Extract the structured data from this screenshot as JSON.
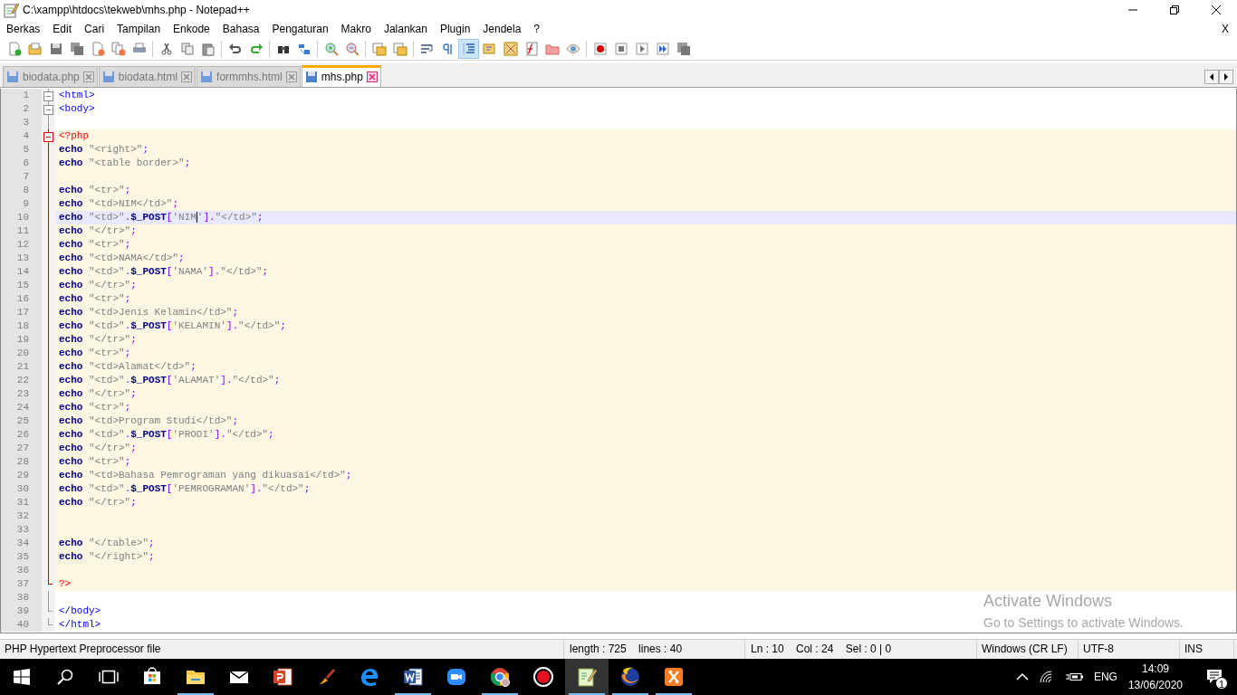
{
  "window": {
    "title": "C:\\xampp\\htdocs\\tekweb\\mhs.php - Notepad++"
  },
  "menu": [
    "Berkas",
    "Edit",
    "Cari",
    "Tampilan",
    "Enkode",
    "Bahasa",
    "Pengaturan",
    "Makro",
    "Jalankan",
    "Plugin",
    "Jendela",
    "?"
  ],
  "menu_close": "X",
  "toolbar": {
    "indent_guide_on": true
  },
  "tabs": [
    {
      "label": "biodata.php",
      "selected": false
    },
    {
      "label": "biodata.html",
      "selected": false
    },
    {
      "label": "formmhs.html",
      "selected": false
    },
    {
      "label": "mhs.php",
      "selected": true
    }
  ],
  "editor": {
    "lines": [
      {
        "num": "1",
        "php": false,
        "fold_start": true,
        "fold_end": false,
        "current": false,
        "tokens": [
          {
            "kind": "tag",
            "text": "<html>"
          }
        ]
      },
      {
        "num": "2",
        "php": false,
        "fold_start": true,
        "fold_end": false,
        "current": false,
        "tokens": [
          {
            "kind": "tag",
            "text": "<body>"
          }
        ]
      },
      {
        "num": "3",
        "php": false,
        "fold_start": false,
        "fold_end": false,
        "current": false
      },
      {
        "num": "4",
        "php": true,
        "fold_start": true,
        "fold_end": false,
        "current": false,
        "tokens": [
          {
            "kind": "php-tag",
            "text": "<?php"
          }
        ]
      },
      {
        "num": "5",
        "php": true,
        "fold_start": false,
        "fold_end": false,
        "current": false,
        "tokens": [
          {
            "kind": "keyword",
            "text": "echo"
          },
          {
            "kind": "string",
            "text": " \"<right>\""
          },
          {
            "kind": "operator",
            "text": ";"
          }
        ]
      },
      {
        "num": "6",
        "php": true,
        "fold_start": false,
        "fold_end": false,
        "current": false,
        "tokens": [
          {
            "kind": "keyword",
            "text": "echo"
          },
          {
            "kind": "string",
            "text": " \"<table border>\""
          },
          {
            "kind": "operator",
            "text": ";"
          }
        ]
      },
      {
        "num": "7",
        "php": true,
        "fold_start": false,
        "fold_end": false,
        "current": false
      },
      {
        "num": "8",
        "php": true,
        "fold_start": false,
        "fold_end": false,
        "current": false,
        "tokens": [
          {
            "kind": "keyword",
            "text": "echo"
          },
          {
            "kind": "string",
            "text": " \"<tr>\""
          },
          {
            "kind": "operator",
            "text": ";"
          }
        ]
      },
      {
        "num": "9",
        "php": true,
        "fold_start": false,
        "fold_end": false,
        "current": false,
        "tokens": [
          {
            "kind": "keyword",
            "text": "echo"
          },
          {
            "kind": "string",
            "text": " \"<td>NIM</td>\""
          },
          {
            "kind": "operator",
            "text": ";"
          }
        ]
      },
      {
        "num": "10",
        "php": true,
        "fold_start": false,
        "fold_end": false,
        "current": true,
        "tokens": [
          {
            "kind": "keyword",
            "text": "echo"
          },
          {
            "kind": "string",
            "text": " \"<td>\""
          },
          {
            "kind": "operator",
            "text": "."
          },
          {
            "kind": "keyword",
            "text": "$_POST"
          },
          {
            "kind": "operator",
            "text": "["
          },
          {
            "kind": "string",
            "text": "'NIM"
          },
          {
            "kind": "caret-string",
            "text": "'"
          },
          {
            "kind": "operator",
            "text": "]"
          },
          {
            "kind": "operator",
            "text": "."
          },
          {
            "kind": "string",
            "text": "\"</td>\""
          },
          {
            "kind": "operator",
            "text": ";"
          }
        ]
      },
      {
        "num": "11",
        "php": true,
        "fold_start": false,
        "fold_end": false,
        "current": false,
        "tokens": [
          {
            "kind": "keyword",
            "text": "echo"
          },
          {
            "kind": "string",
            "text": " \"</tr>\""
          },
          {
            "kind": "operator",
            "text": ";"
          }
        ]
      },
      {
        "num": "12",
        "php": true,
        "fold_start": false,
        "fold_end": false,
        "current": false,
        "tokens": [
          {
            "kind": "keyword",
            "text": "echo"
          },
          {
            "kind": "string",
            "text": " \"<tr>\""
          },
          {
            "kind": "operator",
            "text": ";"
          }
        ]
      },
      {
        "num": "13",
        "php": true,
        "fold_start": false,
        "fold_end": false,
        "current": false,
        "tokens": [
          {
            "kind": "keyword",
            "text": "echo"
          },
          {
            "kind": "string",
            "text": " \"<td>NAMA</td>\""
          },
          {
            "kind": "operator",
            "text": ";"
          }
        ]
      },
      {
        "num": "14",
        "php": true,
        "fold_start": false,
        "fold_end": false,
        "current": false,
        "tokens": [
          {
            "kind": "keyword",
            "text": "echo"
          },
          {
            "kind": "string",
            "text": " \"<td>\""
          },
          {
            "kind": "operator",
            "text": "."
          },
          {
            "kind": "keyword",
            "text": "$_POST"
          },
          {
            "kind": "operator",
            "text": "["
          },
          {
            "kind": "string",
            "text": "'NAMA'"
          },
          {
            "kind": "operator",
            "text": "]"
          },
          {
            "kind": "operator",
            "text": "."
          },
          {
            "kind": "string",
            "text": "\"</td>\""
          },
          {
            "kind": "operator",
            "text": ";"
          }
        ]
      },
      {
        "num": "15",
        "php": true,
        "fold_start": false,
        "fold_end": false,
        "current": false,
        "tokens": [
          {
            "kind": "keyword",
            "text": "echo"
          },
          {
            "kind": "string",
            "text": " \"</tr>\""
          },
          {
            "kind": "operator",
            "text": ";"
          }
        ]
      },
      {
        "num": "16",
        "php": true,
        "fold_start": false,
        "fold_end": false,
        "current": false,
        "tokens": [
          {
            "kind": "keyword",
            "text": "echo"
          },
          {
            "kind": "string",
            "text": " \"<tr>\""
          },
          {
            "kind": "operator",
            "text": ";"
          }
        ]
      },
      {
        "num": "17",
        "php": true,
        "fold_start": false,
        "fold_end": false,
        "current": false,
        "tokens": [
          {
            "kind": "keyword",
            "text": "echo"
          },
          {
            "kind": "string",
            "text": " \"<td>Jenis Kelamin</td>\""
          },
          {
            "kind": "operator",
            "text": ";"
          }
        ]
      },
      {
        "num": "18",
        "php": true,
        "fold_start": false,
        "fold_end": false,
        "current": false,
        "tokens": [
          {
            "kind": "keyword",
            "text": "echo"
          },
          {
            "kind": "string",
            "text": " \"<td>\""
          },
          {
            "kind": "operator",
            "text": "."
          },
          {
            "kind": "keyword",
            "text": "$_POST"
          },
          {
            "kind": "operator",
            "text": "["
          },
          {
            "kind": "string",
            "text": "'KELAMIN'"
          },
          {
            "kind": "operator",
            "text": "]"
          },
          {
            "kind": "operator",
            "text": "."
          },
          {
            "kind": "string",
            "text": "\"</td>\""
          },
          {
            "kind": "operator",
            "text": ";"
          }
        ]
      },
      {
        "num": "19",
        "php": true,
        "fold_start": false,
        "fold_end": false,
        "current": false,
        "tokens": [
          {
            "kind": "keyword",
            "text": "echo"
          },
          {
            "kind": "string",
            "text": " \"</tr>\""
          },
          {
            "kind": "operator",
            "text": ";"
          }
        ]
      },
      {
        "num": "20",
        "php": true,
        "fold_start": false,
        "fold_end": false,
        "current": false,
        "tokens": [
          {
            "kind": "keyword",
            "text": "echo"
          },
          {
            "kind": "string",
            "text": " \"<tr>\""
          },
          {
            "kind": "operator",
            "text": ";"
          }
        ]
      },
      {
        "num": "21",
        "php": true,
        "fold_start": false,
        "fold_end": false,
        "current": false,
        "tokens": [
          {
            "kind": "keyword",
            "text": "echo"
          },
          {
            "kind": "string",
            "text": " \"<td>Alamat</td>\""
          },
          {
            "kind": "operator",
            "text": ";"
          }
        ]
      },
      {
        "num": "22",
        "php": true,
        "fold_start": false,
        "fold_end": false,
        "current": false,
        "tokens": [
          {
            "kind": "keyword",
            "text": "echo"
          },
          {
            "kind": "string",
            "text": " \"<td>\""
          },
          {
            "kind": "operator",
            "text": "."
          },
          {
            "kind": "keyword",
            "text": "$_POST"
          },
          {
            "kind": "operator",
            "text": "["
          },
          {
            "kind": "string",
            "text": "'ALAMAT'"
          },
          {
            "kind": "operator",
            "text": "]"
          },
          {
            "kind": "operator",
            "text": "."
          },
          {
            "kind": "string",
            "text": "\"</td>\""
          },
          {
            "kind": "operator",
            "text": ";"
          }
        ]
      },
      {
        "num": "23",
        "php": true,
        "fold_start": false,
        "fold_end": false,
        "current": false,
        "tokens": [
          {
            "kind": "keyword",
            "text": "echo"
          },
          {
            "kind": "string",
            "text": " \"</tr>\""
          },
          {
            "kind": "operator",
            "text": ";"
          }
        ]
      },
      {
        "num": "24",
        "php": true,
        "fold_start": false,
        "fold_end": false,
        "current": false,
        "tokens": [
          {
            "kind": "keyword",
            "text": "echo"
          },
          {
            "kind": "string",
            "text": " \"<tr>\""
          },
          {
            "kind": "operator",
            "text": ";"
          }
        ]
      },
      {
        "num": "25",
        "php": true,
        "fold_start": false,
        "fold_end": false,
        "current": false,
        "tokens": [
          {
            "kind": "keyword",
            "text": "echo"
          },
          {
            "kind": "string",
            "text": " \"<td>Program Studi</td>\""
          },
          {
            "kind": "operator",
            "text": ";"
          }
        ]
      },
      {
        "num": "26",
        "php": true,
        "fold_start": false,
        "fold_end": false,
        "current": false,
        "tokens": [
          {
            "kind": "keyword",
            "text": "echo"
          },
          {
            "kind": "string",
            "text": " \"<td>\""
          },
          {
            "kind": "operator",
            "text": "."
          },
          {
            "kind": "keyword",
            "text": "$_POST"
          },
          {
            "kind": "operator",
            "text": "["
          },
          {
            "kind": "string",
            "text": "'PRODI'"
          },
          {
            "kind": "operator",
            "text": "]"
          },
          {
            "kind": "operator",
            "text": "."
          },
          {
            "kind": "string",
            "text": "\"</td>\""
          },
          {
            "kind": "operator",
            "text": ";"
          }
        ]
      },
      {
        "num": "27",
        "php": true,
        "fold_start": false,
        "fold_end": false,
        "current": false,
        "tokens": [
          {
            "kind": "keyword",
            "text": "echo"
          },
          {
            "kind": "string",
            "text": " \"</tr>\""
          },
          {
            "kind": "operator",
            "text": ";"
          }
        ]
      },
      {
        "num": "28",
        "php": true,
        "fold_start": false,
        "fold_end": false,
        "current": false,
        "tokens": [
          {
            "kind": "keyword",
            "text": "echo"
          },
          {
            "kind": "string",
            "text": " \"<tr>\""
          },
          {
            "kind": "operator",
            "text": ";"
          }
        ]
      },
      {
        "num": "29",
        "php": true,
        "fold_start": false,
        "fold_end": false,
        "current": false,
        "tokens": [
          {
            "kind": "keyword",
            "text": "echo"
          },
          {
            "kind": "string",
            "text": " \"<td>Bahasa Pemrograman yang dikuasai</td>\""
          },
          {
            "kind": "operator",
            "text": ";"
          }
        ]
      },
      {
        "num": "30",
        "php": true,
        "fold_start": false,
        "fold_end": false,
        "current": false,
        "tokens": [
          {
            "kind": "keyword",
            "text": "echo"
          },
          {
            "kind": "string",
            "text": " \"<td>\""
          },
          {
            "kind": "operator",
            "text": "."
          },
          {
            "kind": "keyword",
            "text": "$_POST"
          },
          {
            "kind": "operator",
            "text": "["
          },
          {
            "kind": "string",
            "text": "'PEMROGRAMAN'"
          },
          {
            "kind": "operator",
            "text": "]"
          },
          {
            "kind": "operator",
            "text": "."
          },
          {
            "kind": "string",
            "text": "\"</td>\""
          },
          {
            "kind": "operator",
            "text": ";"
          }
        ]
      },
      {
        "num": "31",
        "php": true,
        "fold_start": false,
        "fold_end": false,
        "current": false,
        "tokens": [
          {
            "kind": "keyword",
            "text": "echo"
          },
          {
            "kind": "string",
            "text": " \"</tr>\""
          },
          {
            "kind": "operator",
            "text": ";"
          }
        ]
      },
      {
        "num": "32",
        "php": true,
        "fold_start": false,
        "fold_end": false,
        "current": false
      },
      {
        "num": "33",
        "php": true,
        "fold_start": false,
        "fold_end": false,
        "current": false
      },
      {
        "num": "34",
        "php": true,
        "fold_start": false,
        "fold_end": false,
        "current": false,
        "tokens": [
          {
            "kind": "keyword",
            "text": "echo"
          },
          {
            "kind": "string",
            "text": " \"</table>\""
          },
          {
            "kind": "operator",
            "text": ";"
          }
        ]
      },
      {
        "num": "35",
        "php": true,
        "fold_start": false,
        "fold_end": false,
        "current": false,
        "tokens": [
          {
            "kind": "keyword",
            "text": "echo"
          },
          {
            "kind": "string",
            "text": " \"</right>\""
          },
          {
            "kind": "operator",
            "text": ";"
          }
        ]
      },
      {
        "num": "36",
        "php": true,
        "fold_start": false,
        "fold_end": false,
        "current": false
      },
      {
        "num": "37",
        "php": true,
        "fold_start": false,
        "fold_end": true,
        "current": false,
        "tokens": [
          {
            "kind": "php-tag",
            "text": "?>"
          }
        ]
      },
      {
        "num": "38",
        "php": false,
        "fold_start": false,
        "fold_end": false,
        "current": false
      },
      {
        "num": "39",
        "php": false,
        "fold_start": false,
        "fold_end": true,
        "current": false,
        "tokens": [
          {
            "kind": "tag",
            "text": "</body>"
          }
        ]
      },
      {
        "num": "40",
        "php": false,
        "fold_start": false,
        "fold_end": true,
        "current": false,
        "tokens": [
          {
            "kind": "tag",
            "text": "</html>"
          }
        ]
      }
    ]
  },
  "activation_notice": {
    "title": "Activate Windows",
    "text": "Go to Settings to activate Windows."
  },
  "status_bar": [
    "PHP Hypertext Preprocessor file",
    "length : 725    lines : 40",
    "Ln : 10    Col : 24    Sel : 0 | 0",
    "Windows (CR LF)",
    "UTF-8",
    "INS"
  ],
  "taskbar": {
    "apps": [
      {
        "kind": "store",
        "running": false,
        "active": false
      },
      {
        "kind": "folder",
        "running": true,
        "active": false
      },
      {
        "kind": "mail",
        "running": false,
        "active": false
      },
      {
        "kind": "slides",
        "running": false,
        "active": false
      },
      {
        "kind": "brush",
        "running": false,
        "active": false
      },
      {
        "kind": "browser-e",
        "running": false,
        "active": false
      },
      {
        "kind": "doc",
        "running": true,
        "active": false
      },
      {
        "kind": "camera",
        "running": false,
        "active": false
      },
      {
        "kind": "chrome",
        "running": true,
        "active": false
      },
      {
        "kind": "record",
        "running": false,
        "active": false
      },
      {
        "kind": "notepad",
        "running": true,
        "active": true
      },
      {
        "kind": "fox",
        "running": true,
        "active": false
      },
      {
        "kind": "xampp",
        "running": true,
        "active": false
      }
    ],
    "language": "ENG",
    "time": "14:09",
    "date": "13/06/2020",
    "notifications": "1"
  }
}
